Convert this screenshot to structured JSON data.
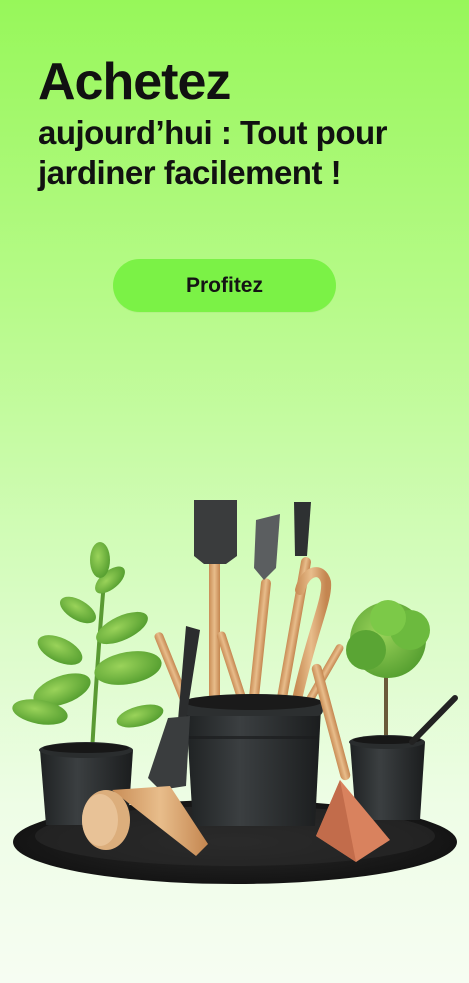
{
  "promo": {
    "title": "Achetez",
    "subtitle_line1": "aujourd’hui : Tout pour",
    "subtitle_line2": "jardiner facilement !",
    "cta_label": "Profitez"
  },
  "illustration": {
    "subject": "garden-tools-and-potted-plants"
  },
  "colors": {
    "background_top": "#97f75a",
    "background_bottom": "#f6fdf2",
    "cta_background": "#7bf246",
    "text": "#111111",
    "pot": "#2f3233",
    "wood": "#d9a873",
    "soil": "#1f1f1f"
  }
}
